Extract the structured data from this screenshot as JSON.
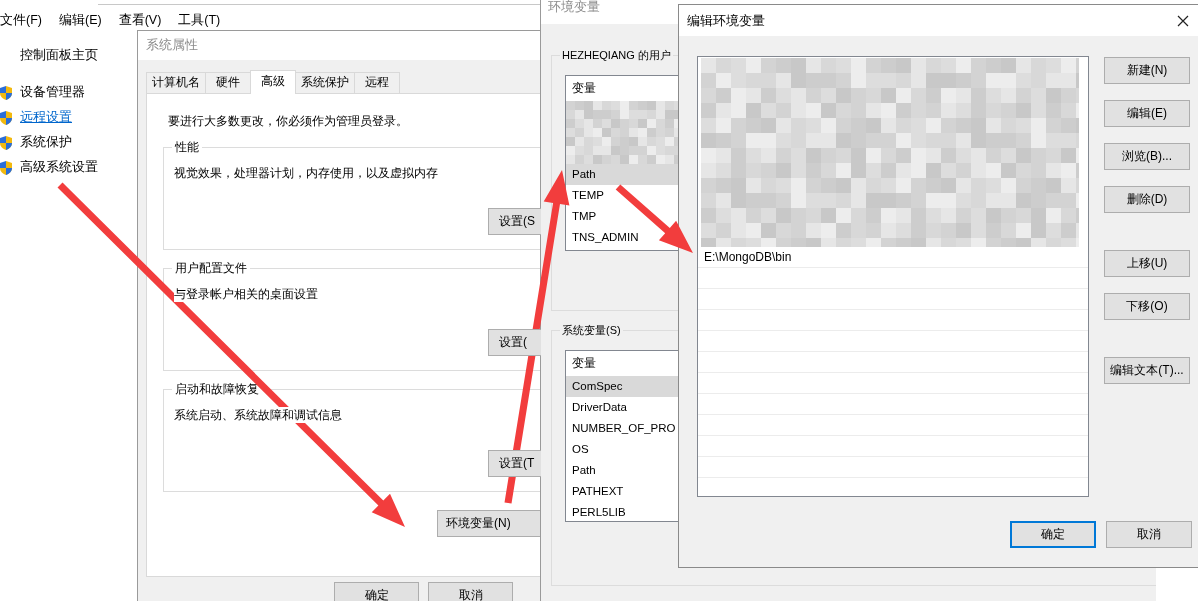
{
  "explorer": {
    "menu": [
      "文件(F)",
      "编辑(E)",
      "查看(V)",
      "工具(T)"
    ],
    "sidebar": {
      "home": "控制面板主页",
      "items": [
        {
          "label": "设备管理器",
          "hovered": false
        },
        {
          "label": "远程设置",
          "hovered": true
        },
        {
          "label": "系统保护",
          "hovered": false
        },
        {
          "label": "高级系统设置",
          "hovered": false
        }
      ]
    }
  },
  "system_properties": {
    "title": "系统属性",
    "tabs": [
      {
        "label": "计算机名",
        "selected": false
      },
      {
        "label": "硬件",
        "selected": false
      },
      {
        "label": "高级",
        "selected": true
      },
      {
        "label": "系统保护",
        "selected": false
      },
      {
        "label": "远程",
        "selected": false
      }
    ],
    "notice": "要进行大多数更改，你必须作为管理员登录。",
    "groups": [
      {
        "title": "性能",
        "description": "视觉效果，处理器计划，内存使用，以及虚拟内存",
        "button": "设置(S"
      },
      {
        "title": "用户配置文件",
        "description": "与登录帐户相关的桌面设置",
        "button": "设置("
      },
      {
        "title": "启动和故障恢复",
        "description": "系统启动、系统故障和调试信息",
        "button": "设置(T"
      }
    ],
    "env_button": "环境变量(N)",
    "buttons": [
      "确定",
      "取消"
    ]
  },
  "environment_variables": {
    "title": "环境变量",
    "user_group": {
      "title": "HEZHEQIANG 的用户",
      "header": "变量",
      "rows": [
        {
          "name": "Path",
          "selected": true
        },
        {
          "name": "TEMP",
          "selected": false
        },
        {
          "name": "TMP",
          "selected": false
        },
        {
          "name": "TNS_ADMIN",
          "selected": false
        }
      ]
    },
    "system_group": {
      "title": "系统变量(S)",
      "header": "变量",
      "rows": [
        {
          "name": "ComSpec",
          "selected": true
        },
        {
          "name": "DriverData",
          "selected": false
        },
        {
          "name": "NUMBER_OF_PRO",
          "selected": false
        },
        {
          "name": "OS",
          "selected": false
        },
        {
          "name": "Path",
          "selected": false
        },
        {
          "name": "PATHEXT",
          "selected": false
        },
        {
          "name": "PERL5LIB",
          "selected": false
        }
      ]
    }
  },
  "edit_dialog": {
    "title": "编辑环境变量",
    "entries": [
      "E:\\MongoDB\\bin"
    ],
    "side_buttons": [
      "新建(N)",
      "编辑(E)",
      "浏览(B)...",
      "删除(D)",
      "上移(U)",
      "下移(O)",
      "编辑文本(T)..."
    ],
    "footer_buttons": [
      {
        "label": "确定",
        "default": true
      },
      {
        "label": "取消",
        "default": false
      }
    ]
  }
}
